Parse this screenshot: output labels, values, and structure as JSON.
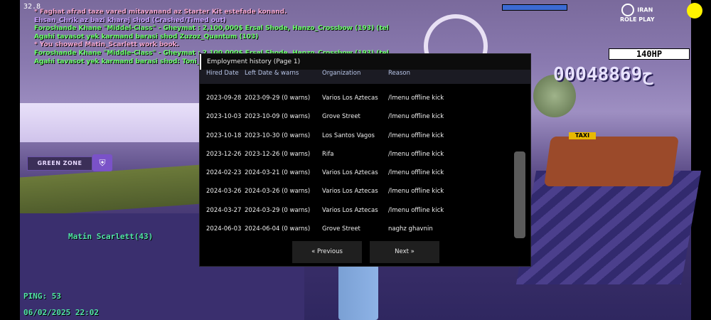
{
  "hud": {
    "fps": "32.8",
    "hp_text": "140HP",
    "money": "00048869",
    "money_prefix": "ح",
    "health_fraction": 1.0,
    "logo_line1": "IRAN",
    "logo_line2": "ROLE PLAY",
    "green_zone": "GREEN ZONE",
    "player_name": "Matin Scarlett(43)",
    "ping": "PING: 53",
    "datetime": "06/02/2025 22:02",
    "taxi": "TAXI"
  },
  "chat": [
    {
      "text": "* Faghat afrad taze vared mitavanand az Starter Kit estefade konand.",
      "color": "#f4a7d1"
    },
    {
      "text": "Ehsan_Chrik az bazi kharej shod (Crashed/Timed out)",
      "color": "#c9a0ff"
    },
    {
      "text": "Foroshande Khane \"Middel-Class\" - Gheymat : 2,100,000$ Ersal Shode, Hanzo_Crossbow (193) (tel. 180660)",
      "color": "#6bff6b"
    },
    {
      "text": "Agahi tavasot yek karmand barasi shod Zuzoz_Quantum (103)",
      "color": "#6bff6b"
    },
    {
      "text": "* You showed Matin_Scarlett work book.",
      "color": "#f4a7d1"
    },
    {
      "text": "Foroshande Khane \"Middle-Class\" - Gheymat : 2,100,000$ Ersal Shode, Hanzo_Crossbow (193) (tel. 180660)",
      "color": "#6bff6b"
    },
    {
      "text": "Agahi tavasot yek karmand barasi shod: Toni_Mollafe...",
      "color": "#6bff6b"
    }
  ],
  "dialog": {
    "title": "Employment history (Page 1)",
    "headers": {
      "hired": "Hired Date",
      "left": "Left Date & warns",
      "org": "Organization",
      "reason": "Reason"
    },
    "rows": [
      {
        "hired": "2023-09-28",
        "left": "2023-09-29 (0 warns)",
        "org": "Varios Los Aztecas",
        "reason": "/lmenu offline kick"
      },
      {
        "hired": "2023-10-03",
        "left": "2023-10-09 (0 warns)",
        "org": "Grove Street",
        "reason": "/lmenu offline kick"
      },
      {
        "hired": "2023-10-18",
        "left": "2023-10-30 (0 warns)",
        "org": "Los Santos Vagos",
        "reason": "/lmenu offline kick"
      },
      {
        "hired": "2023-12-26",
        "left": "2023-12-26 (0 warns)",
        "org": "Rifa",
        "reason": "/lmenu offline kick"
      },
      {
        "hired": "2024-02-23",
        "left": "2024-03-21 (0 warns)",
        "org": "Varios Los Aztecas",
        "reason": "/lmenu offline kick"
      },
      {
        "hired": "2024-03-26",
        "left": "2024-03-26 (0 warns)",
        "org": "Varios Los Aztecas",
        "reason": "/lmenu offline kick"
      },
      {
        "hired": "2024-03-27",
        "left": "2024-03-29 (0 warns)",
        "org": "Varios Los Aztecas",
        "reason": "/lmenu offline kick"
      },
      {
        "hired": "2024-06-03",
        "left": "2024-06-04 (0 warns)",
        "org": "Grove Street",
        "reason": "naghz ghavnin"
      }
    ],
    "prev_label": "« Previous",
    "next_label": "Next »"
  },
  "colors": {
    "hud_green": "#52e5a7",
    "header_text": "#b7c4e6",
    "health_blue": "#3b6bd4"
  }
}
